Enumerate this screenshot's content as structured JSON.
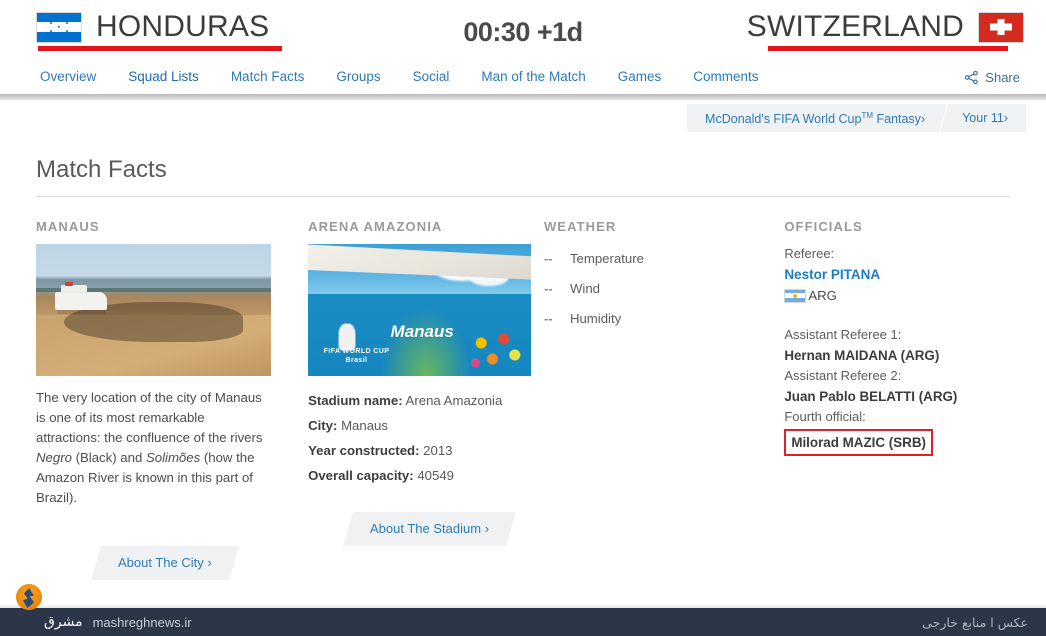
{
  "header": {
    "home_team": "HONDURAS",
    "away_team": "SWITZERLAND",
    "kickoff": "00:30 +1d",
    "home_flag_icon": "honduras-flag-icon",
    "away_flag_icon": "switzerland-flag-icon",
    "accent_red": "#e2161a",
    "accent_blue": "#2b7bb9"
  },
  "nav": {
    "items": [
      {
        "label": "Overview",
        "active": false
      },
      {
        "label": "Squad Lists",
        "active": true
      },
      {
        "label": "Match Facts",
        "active": false
      },
      {
        "label": "Groups",
        "active": false
      },
      {
        "label": "Social",
        "active": false
      },
      {
        "label": "Man of the Match",
        "active": false
      },
      {
        "label": "Games",
        "active": false
      },
      {
        "label": "Comments",
        "active": false
      }
    ],
    "share_label": "Share",
    "share_icon": "share-nodes-icon"
  },
  "fantasy_bar": {
    "promo_label": "McDonald's FIFA World Cup",
    "promo_sup": "TM",
    "promo_suffix": " Fantasy",
    "promo_chevron": "›",
    "your11_label": "Your 11",
    "your11_chevron": "›"
  },
  "main": {
    "page_title": "Match Facts"
  },
  "city": {
    "heading": "MANAUS",
    "photo_alt": "manaus-river-photo",
    "description_part1": "The very location of the city of Manaus is one of its most remarkable attractions: the confluence of the rivers ",
    "river1": "Negro",
    "description_part2": " (Black) and ",
    "river2": "Solimões",
    "description_part3": " (how the Amazon River is known in this part of Brazil).",
    "button_label": "About The City",
    "button_chevron": "›"
  },
  "stadium": {
    "heading": "ARENA AMAZONIA",
    "photo_alt": "arena-amazonia-photo",
    "photo_caption": "Manaus",
    "photo_brand_line1": "FIFA WORLD CUP",
    "photo_brand_line2": "Brasil",
    "facts": [
      {
        "label": "Stadium name:",
        "value": "Arena Amazonia"
      },
      {
        "label": "City:",
        "value": "Manaus"
      },
      {
        "label": "Year constructed:",
        "value": "2013"
      },
      {
        "label": "Overall capacity:",
        "value": "40549"
      }
    ],
    "button_label": "About The Stadium",
    "button_chevron": "›"
  },
  "weather": {
    "heading": "WEATHER",
    "rows": [
      {
        "value": "--",
        "label": "Temperature"
      },
      {
        "value": "--",
        "label": "Wind"
      },
      {
        "value": "--",
        "label": "Humidity"
      }
    ]
  },
  "officials": {
    "heading": "OFFICIALS",
    "referee_label": "Referee:",
    "referee_name": "Nestor PITANA",
    "referee_country_code": "ARG",
    "referee_flag_icon": "argentina-flag-icon",
    "entries": [
      {
        "label": "Assistant Referee 1:",
        "name": "Hernan MAIDANA (ARG)",
        "highlighted": false
      },
      {
        "label": "Assistant Referee 2:",
        "name": "Juan Pablo BELATTI (ARG)",
        "highlighted": false
      },
      {
        "label": "Fourth official:",
        "name": "Milorad MAZIC (SRB)",
        "highlighted": true
      }
    ],
    "highlight_color": "#d8232a"
  },
  "watermark": {
    "logo_icon": "mashregh-flame-logo-icon",
    "site_name_fa": "مشرق",
    "site_url": "mashreghnews.ir",
    "credit_fa": "عکس ا منابع خارجی"
  }
}
